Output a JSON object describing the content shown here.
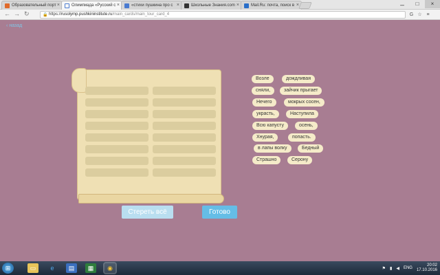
{
  "tabs": [
    {
      "label": "Образовательный порт",
      "color": "#e06b2c"
    },
    {
      "label": "Олимпиада «Русский с",
      "color": "#4a7bd0",
      "active": true
    },
    {
      "label": "«стихи пушкина про с",
      "color": "#4a7bd0"
    },
    {
      "label": "Школьные Знания.com",
      "color": "#333"
    },
    {
      "label": "Mail.Ru: почта, поиск в",
      "color": "#2a6fc9"
    }
  ],
  "address": {
    "scheme": "https://",
    "host": "rusolymp.pushkininstitute.ru",
    "path": "/main_cards/main_tour_card_4"
  },
  "back_label": "назад",
  "words": [
    {
      "text": "Возле"
    },
    {
      "text": "дождливая"
    },
    {
      "text": "сняли,"
    },
    {
      "text": "зайчик прыгает"
    },
    {
      "text": "Нечего"
    },
    {
      "text": "мокрых сосен,"
    },
    {
      "text": "украсть,"
    },
    {
      "text": "Наступила"
    },
    {
      "text": "Всю капусту"
    },
    {
      "text": "осень,"
    },
    {
      "text": "Хнурая,"
    },
    {
      "text": "попасть."
    },
    {
      "text": "в лапы волку"
    },
    {
      "text": "Бедный"
    },
    {
      "text": "Страшно"
    },
    {
      "text": "Серону"
    }
  ],
  "buttons": {
    "clear": "Стереть всё",
    "done": "Готово"
  },
  "tray": {
    "lang": "ENG",
    "time": "20:02",
    "date": "17.10.2016"
  }
}
